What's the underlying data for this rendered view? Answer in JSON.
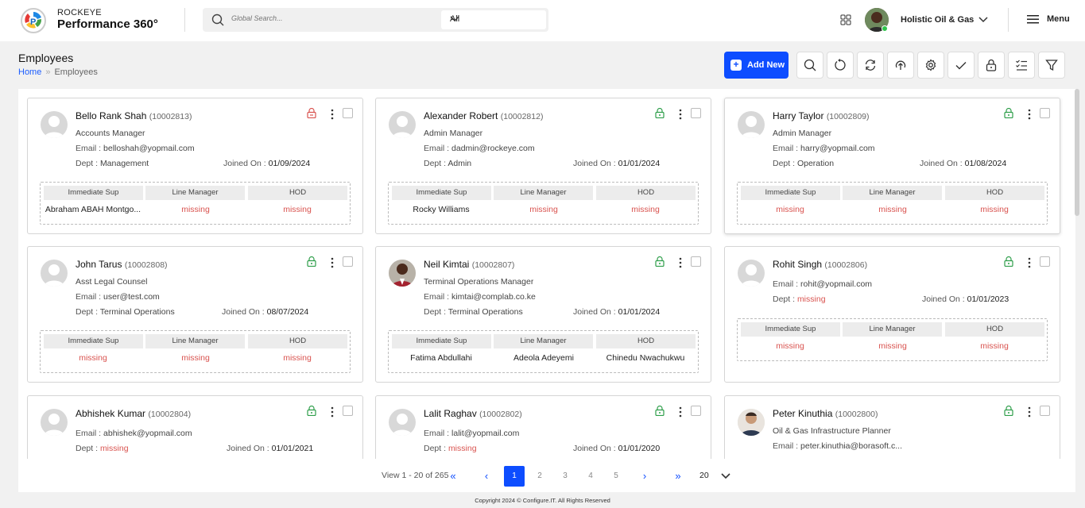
{
  "brand": {
    "company_line": "ROCKEYE",
    "product_line": "Performance 360°"
  },
  "search": {
    "placeholder": "Global Search...",
    "scope": "All"
  },
  "user": {
    "company": "Holistic Oil & Gas"
  },
  "menu_label": "Menu",
  "page": {
    "title": "Employees",
    "breadcrumb_home": "Home",
    "breadcrumb_sep": "»",
    "breadcrumb_current": "Employees"
  },
  "toolbar": {
    "add_new": "Add New",
    "add_icon": "+"
  },
  "sup_headers": {
    "immediate": "Immediate Sup",
    "line": "Line Manager",
    "hod": "HOD"
  },
  "labels": {
    "email": "Email :",
    "dept": "Dept :",
    "joined": "Joined On :"
  },
  "employees": [
    {
      "name": "Bello Rank Shah",
      "id": "(10002813)",
      "role": "Accounts Manager",
      "email": "belloshah@yopmail.com",
      "dept": "Management",
      "joined": "01/09/2024",
      "immediate": "Abraham ABAH Montgo...",
      "line": "missing",
      "hod": "missing",
      "lock_color": "#d9534f"
    },
    {
      "name": "Alexander Robert",
      "id": "(10002812)",
      "role": "Admin Manager",
      "email": "dadmin@rockeye.com",
      "dept": "Admin",
      "joined": "01/01/2024",
      "immediate": "Rocky Williams",
      "line": "missing",
      "hod": "missing",
      "lock_color": "#2e9e4a"
    },
    {
      "name": "Harry Taylor",
      "id": "(10002809)",
      "role": "Admin Manager",
      "email": "harry@yopmail.com",
      "dept": "Operation",
      "joined": "01/08/2024",
      "immediate": "missing",
      "line": "missing",
      "hod": "missing",
      "lock_color": "#2e9e4a"
    },
    {
      "name": "John Tarus",
      "id": "(10002808)",
      "role": "Asst Legal Counsel",
      "email": "user@test.com",
      "dept": "Terminal Operations",
      "joined": "08/07/2024",
      "immediate": "missing",
      "line": "missing",
      "hod": "missing",
      "lock_color": "#2e9e4a"
    },
    {
      "name": "Neil Kimtai",
      "id": "(10002807)",
      "role": "Terminal Operations Manager",
      "email": "kimtai@complab.co.ke",
      "dept": "Terminal Operations",
      "joined": "01/01/2024",
      "immediate": "Fatima Abdullahi",
      "line": "Adeola Adeyemi",
      "hod": "Chinedu Nwachukwu",
      "lock_color": "#2e9e4a"
    },
    {
      "name": "Rohit Singh",
      "id": "(10002806)",
      "role": "",
      "email": "rohit@yopmail.com",
      "dept": "missing",
      "joined": "01/01/2023",
      "immediate": "missing",
      "line": "missing",
      "hod": "missing",
      "lock_color": "#2e9e4a"
    },
    {
      "name": "Abhishek Kumar",
      "id": "(10002804)",
      "role": "",
      "email": "abhishek@yopmail.com",
      "dept": "missing",
      "joined": "01/01/2021",
      "lock_color": "#2e9e4a"
    },
    {
      "name": "Lalit Raghav",
      "id": "(10002802)",
      "role": "",
      "email": "lalit@yopmail.com",
      "dept": "missing",
      "joined": "01/01/2020",
      "lock_color": "#2e9e4a"
    },
    {
      "name": "Peter Kinuthia",
      "id": "(10002800)",
      "role": "Oil & Gas Infrastructure Planner",
      "email": "peter.kinuthia@borasoft.c...",
      "lock_color": "#2e9e4a"
    }
  ],
  "pagination": {
    "info": "View 1 - 20 of 265",
    "first": "«",
    "prev": "‹",
    "pages": [
      "1",
      "2",
      "3",
      "4",
      "5"
    ],
    "next": "›",
    "last": "»",
    "page_size": "20"
  },
  "footer": "Copyright 2024 © Configure.IT. All Rights Reserved",
  "colors": {
    "accent": "#0d4dff",
    "missing": "#d9534f",
    "unlocked": "#2e9e4a"
  }
}
